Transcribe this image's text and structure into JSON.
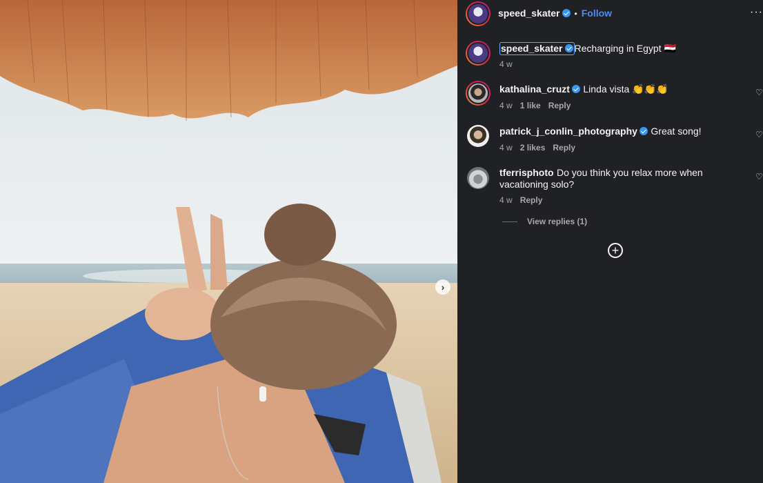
{
  "post": {
    "author": "speed_skater",
    "follow_label": "Follow",
    "separator": "•",
    "more_label": "···",
    "next_label": "›"
  },
  "caption": {
    "username": "speed_skater",
    "text": "Recharging in Egypt 🇪🇬",
    "time": "4 w"
  },
  "comments": [
    {
      "username": "kathalina_cruzt",
      "verified": true,
      "text": "Linda vista 👏👏👏",
      "time": "4 w",
      "likes": "1 like",
      "reply": "Reply"
    },
    {
      "username": "patrick_j_conlin_photography",
      "verified": true,
      "text": "Great song!",
      "time": "4 w",
      "likes": "2 likes",
      "reply": "Reply"
    },
    {
      "username": "tferrisphoto",
      "verified": false,
      "text": "Do you think you relax more when vacationing solo?",
      "time": "4 w",
      "likes": "",
      "reply": "Reply"
    }
  ],
  "view_replies": "View replies (1)",
  "icons": {
    "heart": "♡",
    "load_more": "+"
  },
  "colors": {
    "panel": "#1f2125",
    "accent": "#4a8df8",
    "verified": "#3897f0"
  }
}
